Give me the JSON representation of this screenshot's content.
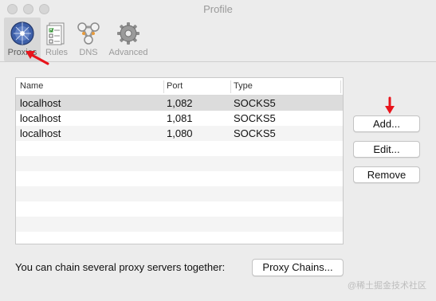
{
  "window": {
    "title": "Profile"
  },
  "toolbar": {
    "items": [
      {
        "label": "Proxies",
        "icon": "globe-network-icon",
        "selected": true
      },
      {
        "label": "Rules",
        "icon": "checklist-icon",
        "selected": false
      },
      {
        "label": "DNS",
        "icon": "dns-nodes-icon",
        "selected": false
      },
      {
        "label": "Advanced",
        "icon": "gear-icon",
        "selected": false
      }
    ]
  },
  "proxy_table": {
    "columns": [
      "Name",
      "Port",
      "Type"
    ],
    "rows": [
      {
        "name": "localhost",
        "port": "1,082",
        "type": "SOCKS5",
        "selected": true
      },
      {
        "name": "localhost",
        "port": "1,081",
        "type": "SOCKS5",
        "selected": false
      },
      {
        "name": "localhost",
        "port": "1,080",
        "type": "SOCKS5",
        "selected": false
      }
    ]
  },
  "actions": {
    "add_label": "Add...",
    "edit_label": "Edit...",
    "remove_label": "Remove"
  },
  "footer": {
    "chain_text": "You can chain several proxy servers together:",
    "chain_button": "Proxy Chains..."
  },
  "watermark": "@稀土掘金技术社区",
  "colors": {
    "annotation_arrow": "#e8141b",
    "selected_row": "#dcdcdc",
    "background": "#ececec"
  }
}
